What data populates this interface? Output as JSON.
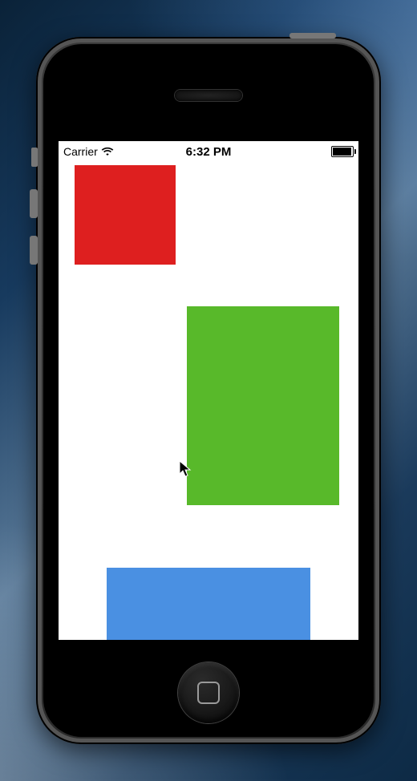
{
  "status_bar": {
    "carrier": "Carrier",
    "time": "6:32 PM"
  },
  "blocks": {
    "red": {
      "color": "#de1f1f"
    },
    "green": {
      "color": "#58b92a"
    },
    "blue": {
      "color": "#4a90e2"
    }
  }
}
